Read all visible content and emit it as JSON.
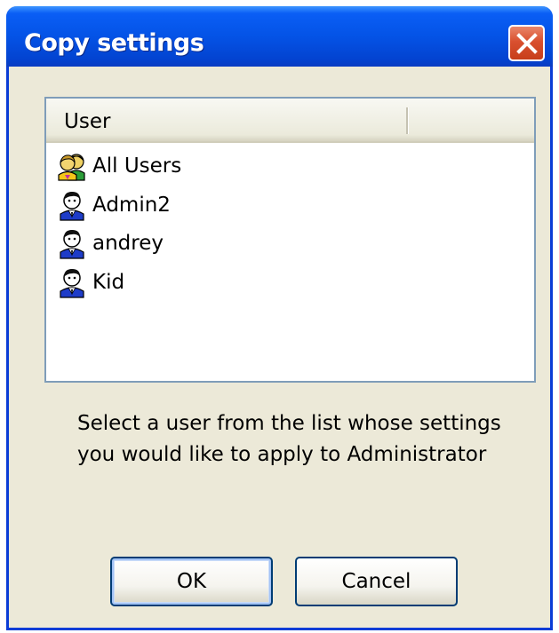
{
  "window": {
    "title": "Copy settings",
    "close_icon": "close-x-icon"
  },
  "list": {
    "columns": [
      "User",
      ""
    ],
    "items": [
      {
        "label": "All Users",
        "icon": "users-group-icon"
      },
      {
        "label": "Admin2",
        "icon": "user-icon"
      },
      {
        "label": "andrey",
        "icon": "user-icon"
      },
      {
        "label": "Kid",
        "icon": "user-icon"
      }
    ]
  },
  "instruction": "Select a user from the list whose settings you would like to apply to Administrator",
  "buttons": {
    "ok_label": "OK",
    "cancel_label": "Cancel"
  },
  "colors": {
    "titlebar": "#0453e6",
    "dialog_bg": "#ece9d8",
    "close_button": "#d9502f",
    "button_border": "#003c74"
  }
}
